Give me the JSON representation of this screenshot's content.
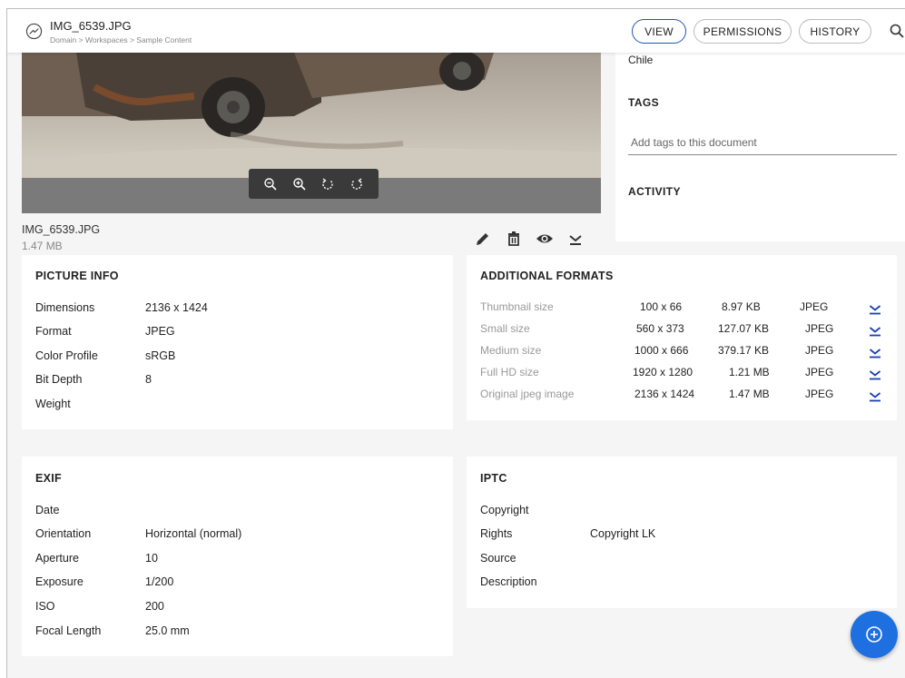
{
  "header": {
    "title": "IMG_6539.JPG",
    "breadcrumb": "Domain > Workspaces > Sample Content",
    "tabs": [
      {
        "label": "VIEW",
        "active": true
      },
      {
        "label": "PERMISSIONS",
        "active": false
      },
      {
        "label": "HISTORY",
        "active": false
      }
    ]
  },
  "viewer": {
    "controls": [
      "zoom-out-icon",
      "zoom-in-icon",
      "rotate-left-icon",
      "rotate-right-icon"
    ]
  },
  "file": {
    "name": "IMG_6539.JPG",
    "size": "1.47 MB",
    "actions": [
      "edit-icon",
      "delete-icon",
      "preview-icon",
      "download-icon"
    ]
  },
  "side_panel": {
    "location": "Chile",
    "tags_heading": "TAGS",
    "tags_placeholder": "Add tags to this document",
    "activity_heading": "ACTIVITY"
  },
  "picture_info": {
    "title": "PICTURE INFO",
    "rows": [
      {
        "label": "Dimensions",
        "value": "2136 x 1424"
      },
      {
        "label": "Format",
        "value": "JPEG"
      },
      {
        "label": "Color Profile",
        "value": "sRGB"
      },
      {
        "label": "Bit Depth",
        "value": "8"
      },
      {
        "label": "Weight",
        "value": ""
      }
    ]
  },
  "additional_formats": {
    "title": "ADDITIONAL FORMATS",
    "rows": [
      {
        "name": "Thumbnail size",
        "dims": "100 x 66",
        "size": "8.97 KB",
        "type": "JPEG"
      },
      {
        "name": "Small size",
        "dims": "560 x 373",
        "size": "127.07 KB",
        "type": "JPEG"
      },
      {
        "name": "Medium size",
        "dims": "1000 x 666",
        "size": "379.17 KB",
        "type": "JPEG"
      },
      {
        "name": "Full HD size",
        "dims": "1920 x 1280",
        "size": "1.21 MB",
        "type": "JPEG"
      },
      {
        "name": "Original jpeg image",
        "dims": "2136 x 1424",
        "size": "1.47 MB",
        "type": "JPEG"
      }
    ]
  },
  "exif": {
    "title": "EXIF",
    "rows": [
      {
        "label": "Date",
        "value": ""
      },
      {
        "label": "Orientation",
        "value": "Horizontal (normal)"
      },
      {
        "label": "Aperture",
        "value": "10"
      },
      {
        "label": "Exposure",
        "value": "1/200"
      },
      {
        "label": "ISO",
        "value": "200"
      },
      {
        "label": "Focal Length",
        "value": "25.0 mm"
      }
    ]
  },
  "iptc": {
    "title": "IPTC",
    "rows": [
      {
        "label": "Copyright",
        "value": ""
      },
      {
        "label": "Rights",
        "value": "Copyright LK"
      },
      {
        "label": "Source",
        "value": ""
      },
      {
        "label": "Description",
        "value": ""
      }
    ]
  },
  "colors": {
    "accent": "#2155b5",
    "fab": "#1e6fe0",
    "download_link": "#1a3fb0"
  }
}
